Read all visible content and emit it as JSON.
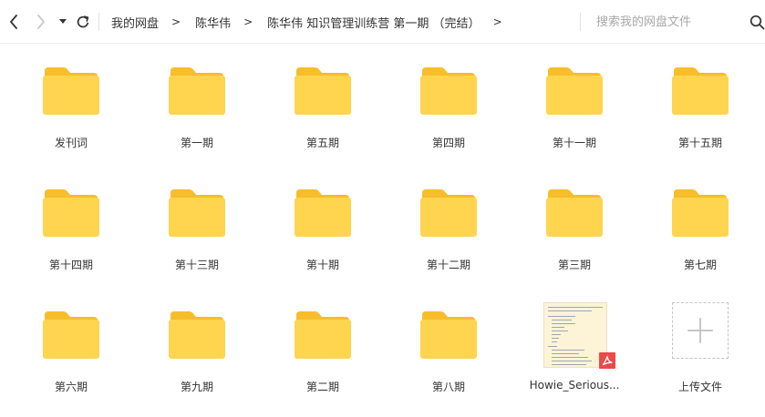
{
  "breadcrumb": {
    "items": [
      {
        "label": "我的网盘"
      },
      {
        "label": "陈华伟"
      },
      {
        "label": "陈华伟 知识管理训练营 第一期 （完结）"
      }
    ],
    "separator": ">"
  },
  "search": {
    "placeholder": "搜索我的网盘文件"
  },
  "files": [
    {
      "label": "发刊词",
      "kind": "folder"
    },
    {
      "label": "第一期",
      "kind": "folder"
    },
    {
      "label": "第五期",
      "kind": "folder"
    },
    {
      "label": "第四期",
      "kind": "folder"
    },
    {
      "label": "第十一期",
      "kind": "folder"
    },
    {
      "label": "第十五期",
      "kind": "folder"
    },
    {
      "label": "第十四期",
      "kind": "folder"
    },
    {
      "label": "第十三期",
      "kind": "folder"
    },
    {
      "label": "第十期",
      "kind": "folder"
    },
    {
      "label": "第十二期",
      "kind": "folder"
    },
    {
      "label": "第三期",
      "kind": "folder"
    },
    {
      "label": "第七期",
      "kind": "folder"
    },
    {
      "label": "第六期",
      "kind": "folder"
    },
    {
      "label": "第九期",
      "kind": "folder"
    },
    {
      "label": "第二期",
      "kind": "folder"
    },
    {
      "label": "第八期",
      "kind": "folder"
    },
    {
      "label": "Howie_Serious...",
      "kind": "pdf"
    }
  ],
  "upload": {
    "label": "上传文件"
  },
  "colors": {
    "folder_body": "#ffd44e",
    "folder_tab": "#f7bd2b",
    "pdf_badge": "#ea4a4a",
    "doc_background": "#fdf3d6"
  },
  "icons": {
    "back": "chevron-left-icon",
    "forward": "chevron-right-icon",
    "dropdown": "caret-down-icon",
    "refresh": "refresh-icon",
    "search": "search-icon",
    "folder": "folder-icon",
    "pdf": "pdf-icon",
    "upload": "plus-icon"
  }
}
